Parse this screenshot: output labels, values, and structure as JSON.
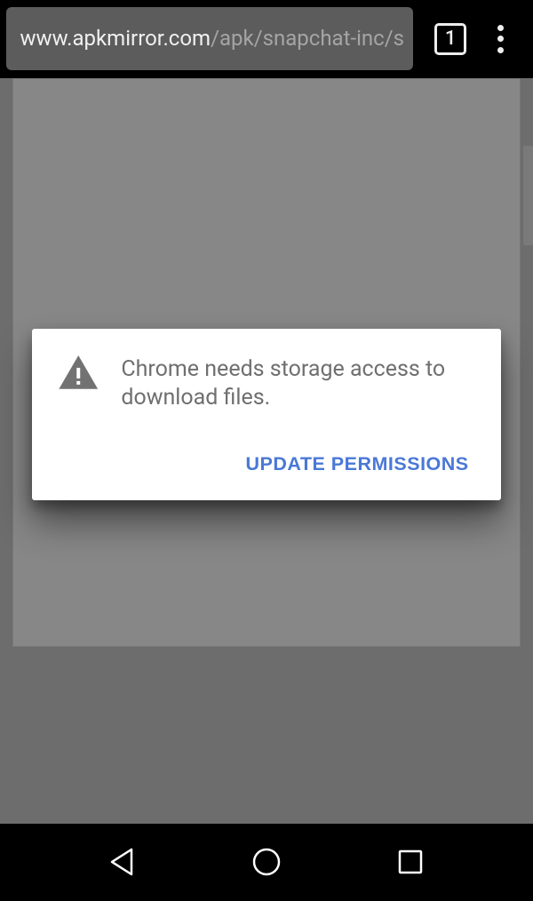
{
  "toolbar": {
    "url_host": "www.apkmirror.com",
    "url_path": "/apk/snapchat-inc/s",
    "tab_count": "1"
  },
  "dialog": {
    "icon_name": "warning-icon",
    "message": "Chrome needs storage access to download files.",
    "action_label": "UPDATE PERMISSIONS"
  },
  "nav": {
    "back": "back",
    "home": "home",
    "recent": "recent"
  }
}
